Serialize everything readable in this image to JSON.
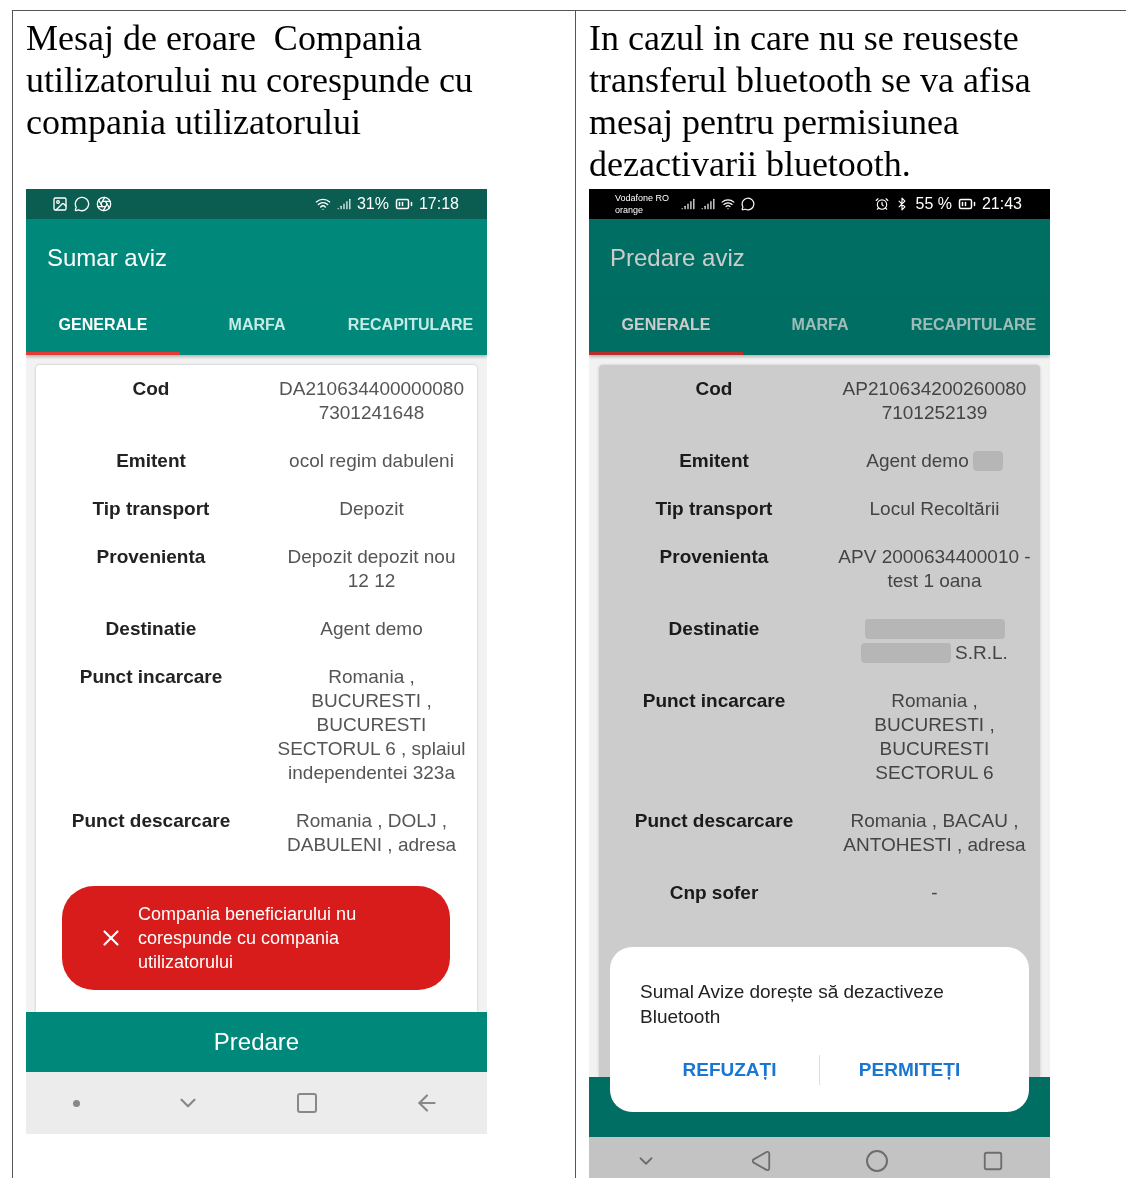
{
  "panels": [
    {
      "caption": "Mesaj de eroare  Compania utilizatorului nu corespunde cu compania utilizatorului",
      "phone": {
        "dimmed": false,
        "status_bar": {
          "kind": "samsung",
          "battery": "31%",
          "time": "17:18"
        },
        "title": "Sumar aviz",
        "tabs": [
          {
            "label": "GENERALE",
            "selected": true
          },
          {
            "label": "MARFA",
            "selected": false
          },
          {
            "label": "RECAPITULARE",
            "selected": false
          }
        ],
        "fields": [
          {
            "label": "Cod",
            "lines": [
              [
                {
                  "kind": "text",
                  "text": "DA210634400000080"
                }
              ],
              [
                {
                  "kind": "text",
                  "text": "7301241648"
                }
              ]
            ]
          },
          {
            "label": "Emitent",
            "lines": [
              [
                {
                  "kind": "text",
                  "text": "ocol regim dabuleni"
                }
              ]
            ]
          },
          {
            "label": "Tip transport",
            "lines": [
              [
                {
                  "kind": "text",
                  "text": "Depozit"
                }
              ]
            ]
          },
          {
            "label": "Provenienta",
            "lines": [
              [
                {
                  "kind": "text",
                  "text": "Depozit depozit nou"
                }
              ],
              [
                {
                  "kind": "text",
                  "text": "12 12"
                }
              ]
            ]
          },
          {
            "label": "Destinatie",
            "lines": [
              [
                {
                  "kind": "text",
                  "text": "Agent demo"
                }
              ]
            ]
          },
          {
            "label": "Punct incarcare",
            "lines": [
              [
                {
                  "kind": "text",
                  "text": "Romania ,"
                }
              ],
              [
                {
                  "kind": "text",
                  "text": "BUCURESTI ,"
                }
              ],
              [
                {
                  "kind": "text",
                  "text": "BUCURESTI"
                }
              ],
              [
                {
                  "kind": "text",
                  "text": "SECTORUL 6 , splaiul"
                }
              ],
              [
                {
                  "kind": "text",
                  "text": "independentei 323a"
                }
              ]
            ]
          },
          {
            "label": "Punct descarcare",
            "lines": [
              [
                {
                  "kind": "text",
                  "text": "Romania , DOLJ ,"
                }
              ],
              [
                {
                  "kind": "text",
                  "text": "DABULENI , adresa"
                }
              ]
            ]
          }
        ],
        "overlay": {
          "kind": "toast",
          "message": "Compania beneficiarului nu corespunde cu compania utilizatorului"
        },
        "footer_button": {
          "kind": "labelled",
          "label": "Predare"
        },
        "nav_bar": {
          "kind": "samsung"
        }
      }
    },
    {
      "caption": "In cazul in care nu se reuseste transferul bluetooth se va afisa mesaj pentru permisiunea dezactivarii bluetooth.",
      "phone": {
        "dimmed": true,
        "status_bar": {
          "kind": "huawei",
          "carrier_lines": [
            "Vodafone RO",
            "orange"
          ],
          "battery": "55 %",
          "time": "21:43"
        },
        "title": "Predare aviz",
        "tabs": [
          {
            "label": "GENERALE",
            "selected": true
          },
          {
            "label": "MARFA",
            "selected": false
          },
          {
            "label": "RECAPITULARE",
            "selected": false
          }
        ],
        "fields": [
          {
            "label": "Cod",
            "lines": [
              [
                {
                  "kind": "text",
                  "text": "AP210634200260080"
                }
              ],
              [
                {
                  "kind": "text",
                  "text": "7101252139"
                }
              ]
            ]
          },
          {
            "label": "Emitent",
            "lines": [
              [
                {
                  "kind": "text",
                  "text": "Agent demo"
                },
                {
                  "kind": "redacted"
                }
              ]
            ]
          },
          {
            "label": "Tip transport",
            "lines": [
              [
                {
                  "kind": "text",
                  "text": "Locul Recoltării"
                }
              ]
            ]
          },
          {
            "label": "Provenienta",
            "lines": [
              [
                {
                  "kind": "text",
                  "text": "APV 2000634400010 -"
                }
              ],
              [
                {
                  "kind": "text",
                  "text": "test 1 oana"
                }
              ]
            ]
          },
          {
            "label": "Destinatie",
            "lines": [
              [
                {
                  "kind": "redacted"
                }
              ],
              [
                {
                  "kind": "redacted"
                },
                {
                  "kind": "text",
                  "text": "S.R.L."
                }
              ]
            ]
          },
          {
            "label": "Punct incarcare",
            "lines": [
              [
                {
                  "kind": "text",
                  "text": "Romania ,"
                }
              ],
              [
                {
                  "kind": "text",
                  "text": "BUCURESTI ,"
                }
              ],
              [
                {
                  "kind": "text",
                  "text": "BUCURESTI"
                }
              ],
              [
                {
                  "kind": "text",
                  "text": "SECTORUL 6"
                }
              ]
            ]
          },
          {
            "label": "Punct descarcare",
            "lines": [
              [
                {
                  "kind": "text",
                  "text": "Romania , BACAU ,"
                }
              ],
              [
                {
                  "kind": "text",
                  "text": "ANTOHESTI , adresa"
                }
              ]
            ]
          },
          {
            "label": "Cnp sofer",
            "lines": [
              [
                {
                  "kind": "text",
                  "text": "-"
                }
              ]
            ]
          }
        ],
        "overlay": {
          "kind": "dialog",
          "message": "Sumal Avize dorește să dezactiveze Bluetooth",
          "buttons": [
            "REFUZAȚI",
            "PERMITEȚI"
          ]
        },
        "footer_button": {
          "kind": "covered"
        },
        "nav_bar": {
          "kind": "huawei"
        }
      }
    }
  ]
}
